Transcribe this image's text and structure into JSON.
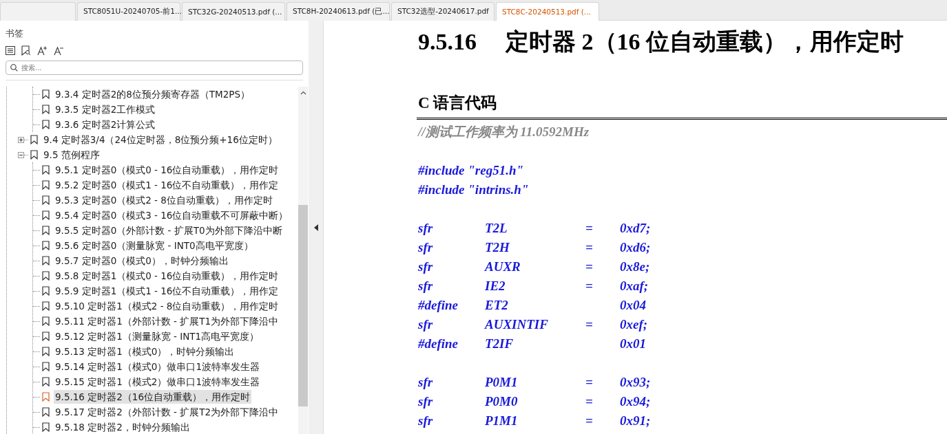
{
  "tabs": [
    {
      "selected": false
    },
    {
      "label": "STC8051U-20240705-前1...",
      "selected": false
    },
    {
      "label": "STC32G-20240513.pdf (...",
      "selected": false
    },
    {
      "label": "STC8H-20240613.pdf (已...",
      "selected": false
    },
    {
      "label": "STC32选型-20240617.pdf",
      "selected": false
    },
    {
      "label": "STC8C-20240513.pdf (...",
      "selected": true
    }
  ],
  "bookmarks": {
    "title": "书签",
    "search": {
      "placeholder": "搜索..."
    },
    "tree": [
      {
        "children": [
          {
            "label": "9.3.4 定时器2的8位预分频寄存器（TM2PS）",
            "selected": false
          },
          {
            "label": "9.3.5  定时器2工作模式",
            "selected": false
          },
          {
            "label": "9.3.6 定时器2计算公式",
            "selected": false
          }
        ]
      },
      {
        "label": "9.4  定时器3/4（24位定时器，8位预分频+16位定时）",
        "selected": false,
        "expanded": false
      },
      {
        "label": "9.5  范例程序",
        "selected": false,
        "expanded": true,
        "children": [
          {
            "label": "9.5.1 定时器0（模式0 - 16位自动重载），用作定时",
            "selected": false
          },
          {
            "label": "9.5.2 定时器0（模式1 - 16位不自动重载），用作定",
            "selected": false
          },
          {
            "label": "9.5.3 定时器0（模式2 - 8位自动重载），用作定时",
            "selected": false
          },
          {
            "label": "9.5.4 定时器0（模式3 - 16位自动重载不可屏蔽中断）",
            "selected": false
          },
          {
            "label": "9.5.5 定时器0（外部计数 - 扩展T0为外部下降沿中断",
            "selected": false
          },
          {
            "label": "9.5.6 定时器0（测量脉宽 - INT0高电平宽度）",
            "selected": false
          },
          {
            "label": "9.5.7 定时器0（模式0），时钟分频输出",
            "selected": false
          },
          {
            "label": "9.5.8 定时器1（模式0 - 16位自动重载），用作定时",
            "selected": false
          },
          {
            "label": "9.5.9 定时器1（模式1 - 16位不自动重载），用作定",
            "selected": false
          },
          {
            "label": "9.5.10 定时器1（模式2 - 8位自动重载），用作定时",
            "selected": false
          },
          {
            "label": "9.5.11 定时器1（外部计数 - 扩展T1为外部下降沿中",
            "selected": false
          },
          {
            "label": "9.5.12 定时器1（测量脉宽 - INT1高电平宽度）",
            "selected": false
          },
          {
            "label": "9.5.13 定时器1（模式0），时钟分频输出",
            "selected": false
          },
          {
            "label": "9.5.14 定时器1（模式0）做串口1波特率发生器",
            "selected": false
          },
          {
            "label": "9.5.15 定时器1（模式2）做串口1波特率发生器",
            "selected": false
          },
          {
            "label": "9.5.16 定时器2（16位自动重载），用作定时",
            "selected": true
          },
          {
            "label": "9.5.17 定时器2（外部计数 - 扩展T2为外部下降沿中",
            "selected": false
          },
          {
            "label": "9.5.18 定时器2，时钟分频输出",
            "selected": false
          }
        ]
      }
    ]
  },
  "document": {
    "section_number": "9.5.16",
    "section_title": "定时器 2（16 位自动重载），用作定时",
    "subheading": "C 语言代码",
    "comment": "//测试工作频率为 11.0592MHz",
    "code_blocks": [
      [
        {
          "kind": "text",
          "text": "#include \"reg51.h\""
        },
        {
          "kind": "text",
          "text": "#include \"intrins.h\""
        }
      ],
      [
        {
          "kind": "decl",
          "keyword": "sfr",
          "name": "T2L",
          "op": "=",
          "value": "0xd7;"
        },
        {
          "kind": "decl",
          "keyword": "sfr",
          "name": "T2H",
          "op": "=",
          "value": "0xd6;"
        },
        {
          "kind": "decl",
          "keyword": "sfr",
          "name": "AUXR",
          "op": "=",
          "value": "0x8e;"
        },
        {
          "kind": "decl",
          "keyword": "sfr",
          "name": "IE2",
          "op": "=",
          "value": "0xaf;"
        },
        {
          "kind": "decl",
          "keyword": "#define",
          "name": "ET2",
          "value": "0x04"
        },
        {
          "kind": "decl",
          "keyword": "sfr",
          "name": "AUXINTIF",
          "op": "=",
          "value": "0xef;"
        },
        {
          "kind": "decl",
          "keyword": "#define",
          "name": "T2IF",
          "value": "0x01"
        }
      ],
      [
        {
          "kind": "decl",
          "keyword": "sfr",
          "name": "P0M1",
          "op": "=",
          "value": "0x93;"
        },
        {
          "kind": "decl",
          "keyword": "sfr",
          "name": "P0M0",
          "op": "=",
          "value": "0x94;"
        },
        {
          "kind": "decl",
          "keyword": "sfr",
          "name": "P1M1",
          "op": "=",
          "value": "0x91;"
        }
      ]
    ]
  }
}
